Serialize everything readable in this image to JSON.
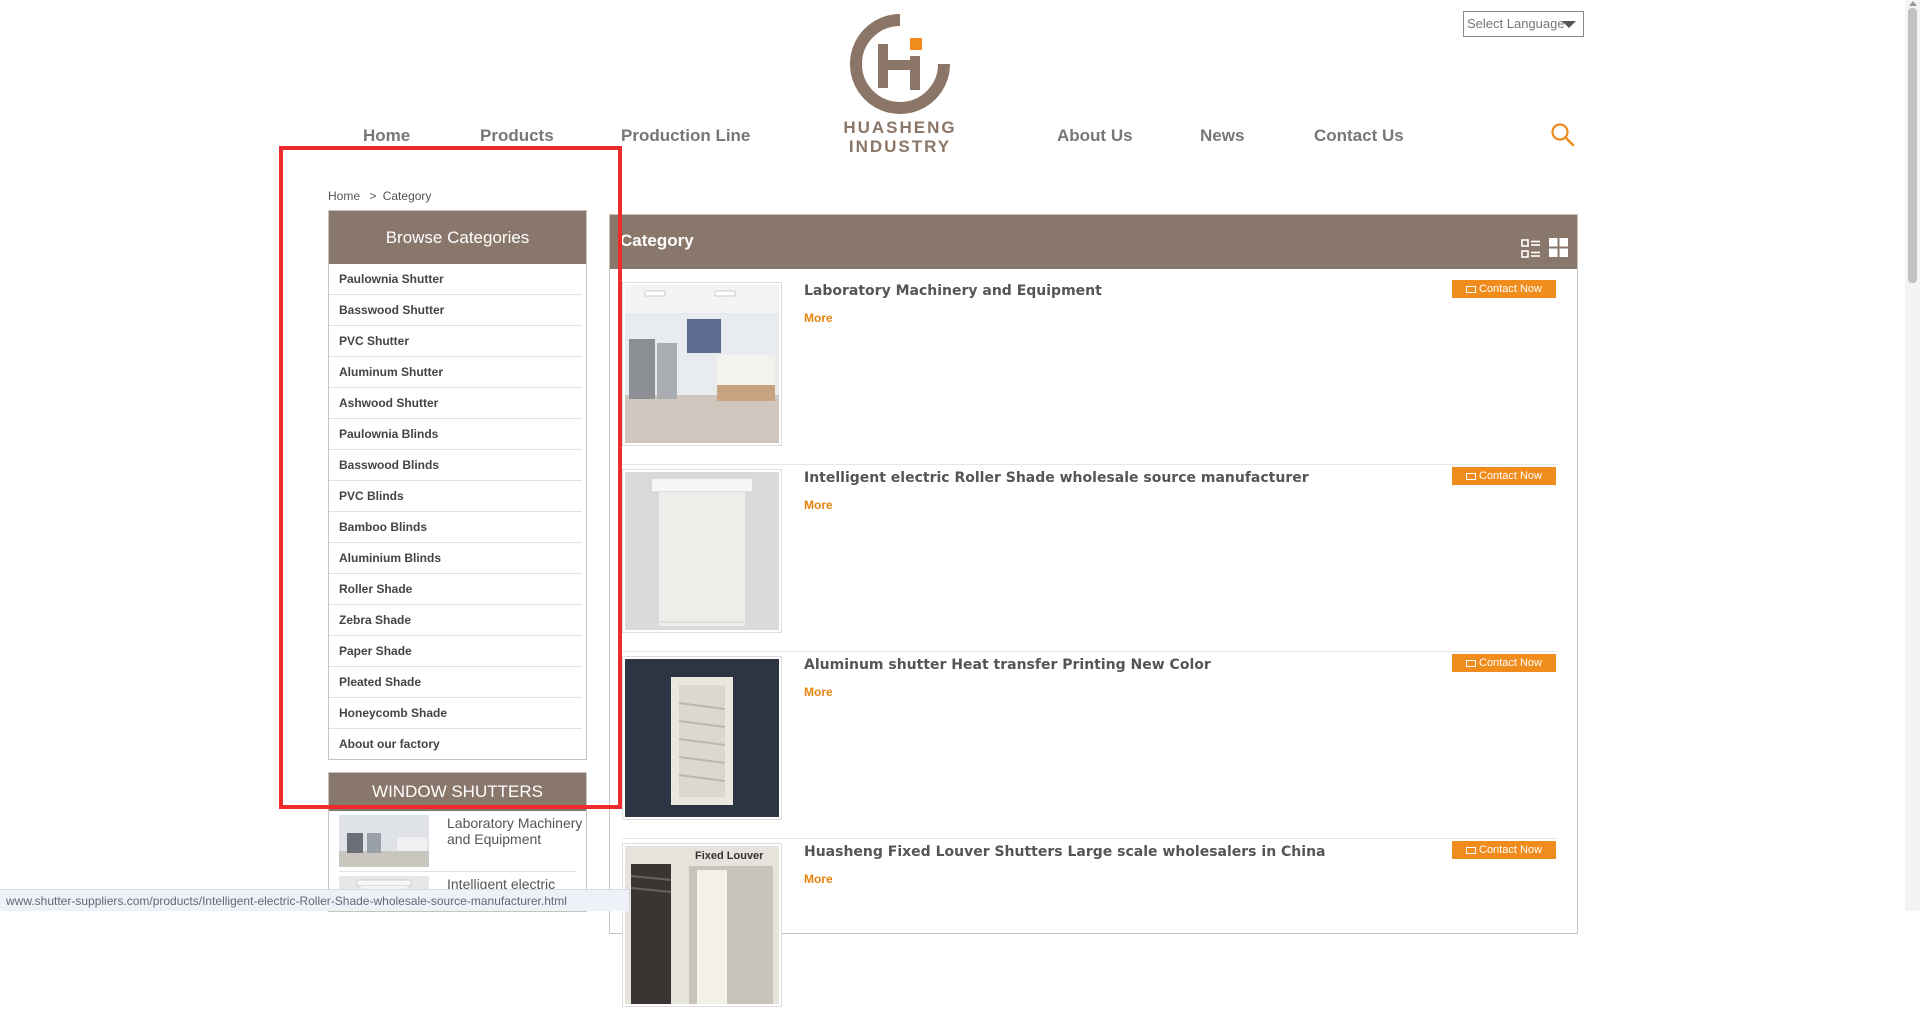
{
  "header": {
    "language_select": "Select Language",
    "logo": {
      "line1": "HUASHENG",
      "line2": "INDUSTRY",
      "brand_color": "#8b7566",
      "accent_color": "#f08c1c"
    },
    "nav_left": [
      "Home",
      "Products",
      "Production Line"
    ],
    "nav_right": [
      "About Us",
      "News",
      "Contact Us"
    ],
    "search_icon": "search-icon"
  },
  "breadcrumb": {
    "home": "Home",
    "separator": ">",
    "current": "Category"
  },
  "sidebar": {
    "title": "Browse Categories",
    "categories": [
      "Paulownia Shutter",
      "Basswood Shutter",
      "PVC Shutter",
      "Aluminum Shutter",
      "Ashwood Shutter",
      "Paulownia Blinds",
      "Basswood Blinds",
      "PVC Blinds",
      "Bamboo Blinds",
      "Aluminium Blinds",
      "Roller Shade",
      "Zebra Shade",
      "Paper Shade",
      "Pleated Shade",
      "Honeycomb Shade",
      "About our factory"
    ],
    "shutters_title": "WINDOW SHUTTERS",
    "shutters_items": [
      "Laboratory Machinery and Equipment",
      "Intelligent electric Roller Shade"
    ]
  },
  "main": {
    "title": "Category",
    "view_icons": [
      "list-view-icon",
      "grid-view-icon"
    ],
    "contact_label": "Contact Now",
    "more_label": "More",
    "products": [
      "Laboratory Machinery and Equipment",
      "Intelligent electric Roller Shade wholesale source manufacturer",
      "Aluminum shutter Heat transfer Printing New Color",
      "Huasheng Fixed Louver Shutters Large scale wholesalers in China"
    ],
    "fixed_louver_label": "Fixed Louver"
  },
  "statusbar": {
    "url": "www.shutter-suppliers.com/products/Intelligent-electric-Roller-Shade-wholesale-source-manufacturer.html"
  },
  "colors": {
    "header_brown": "#8a776b",
    "orange": "#f08c1c",
    "highlight_red": "#ee2b2b"
  }
}
